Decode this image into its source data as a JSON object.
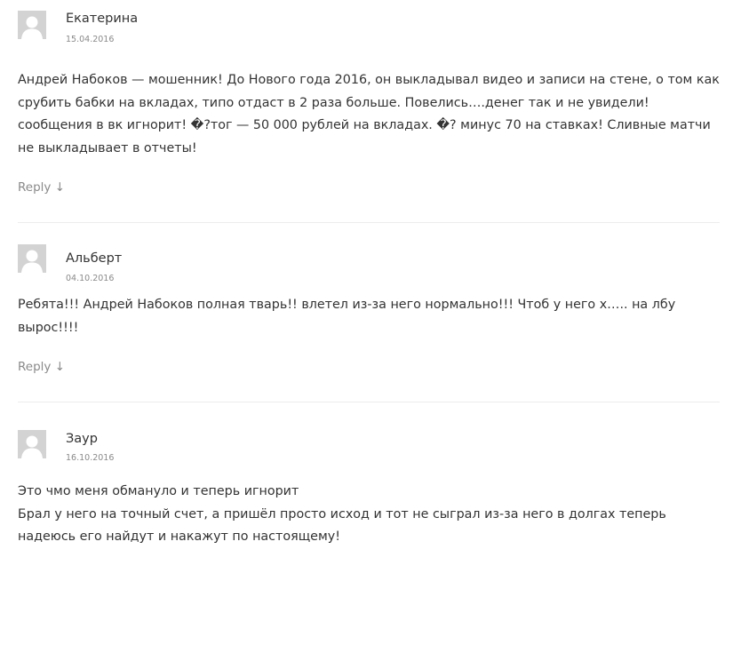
{
  "comments": [
    {
      "author": "Екатерина",
      "date": "15.04.2016",
      "paragraphs": [
        "Андрей Набоков — мошенник! До Нового года 2016, он выкладывал видео и записи на стене, о том как срубить бабки на вкладах, типо отдаст в 2 раза больше. Повелись….денег так и не увидели! сообщения в вк игнорит! �?тог — 50 000 рублей на вкладах. �? минус 70 на ставках! Сливные матчи не выкладывает в отчеты!"
      ],
      "reply_label": "Reply",
      "reply_icon": "↓"
    },
    {
      "author": "Альберт",
      "date": "04.10.2016",
      "paragraphs": [
        "Ребята!!! Андрей Набоков полная тварь!! влетел из-за него нормально!!! Чтоб у него х….. на лбу вырос!!!!"
      ],
      "reply_label": "Reply",
      "reply_icon": "↓"
    },
    {
      "author": "Заур",
      "date": "16.10.2016",
      "paragraphs": [
        "Это чмо меня обмануло и теперь игнорит",
        "Брал у него на точный счет, а пришёл просто исход и тот не сыграл из-за него в долгах теперь надеюсь его найдут и накажут по настоящему!"
      ]
    }
  ],
  "icons": {
    "avatar": "default-user-avatar-icon",
    "reply": "arrow-down-icon"
  },
  "colors": {
    "text": "#333333",
    "meta": "#8a8a8a",
    "avatar_bg": "#d3d3d3",
    "separator": "#ececec"
  }
}
